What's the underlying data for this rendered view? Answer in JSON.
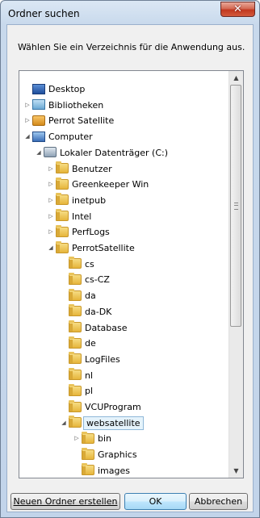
{
  "window": {
    "title": "Ordner suchen",
    "close_label": "✕"
  },
  "description": "Wählen Sie ein Verzeichnis für die Anwendung aus.",
  "tree": [
    {
      "label": "Desktop",
      "icon": "desktop-icon",
      "expander": "",
      "level": 0
    },
    {
      "label": "Bibliotheken",
      "icon": "libraries-icon",
      "expander": "▷",
      "level": 0
    },
    {
      "label": "Perrot Satellite",
      "icon": "user-folder-icon",
      "expander": "▷",
      "level": 0
    },
    {
      "label": "Computer",
      "icon": "computer-icon",
      "expander": "◢",
      "level": 0
    },
    {
      "label": "Lokaler Datenträger (C:)",
      "icon": "drive-icon",
      "expander": "◢",
      "level": 1
    },
    {
      "label": "Benutzer",
      "icon": "folder-icon",
      "expander": "▷",
      "level": 2
    },
    {
      "label": "Greenkeeper Win",
      "icon": "folder-icon",
      "expander": "▷",
      "level": 2
    },
    {
      "label": "inetpub",
      "icon": "folder-icon",
      "expander": "▷",
      "level": 2
    },
    {
      "label": "Intel",
      "icon": "folder-icon",
      "expander": "▷",
      "level": 2
    },
    {
      "label": "PerfLogs",
      "icon": "folder-icon",
      "expander": "▷",
      "level": 2
    },
    {
      "label": "PerrotSatellite",
      "icon": "folder-icon",
      "expander": "◢",
      "level": 2
    },
    {
      "label": "cs",
      "icon": "folder-icon",
      "expander": "",
      "level": 3
    },
    {
      "label": "cs-CZ",
      "icon": "folder-icon",
      "expander": "",
      "level": 3
    },
    {
      "label": "da",
      "icon": "folder-icon",
      "expander": "",
      "level": 3
    },
    {
      "label": "da-DK",
      "icon": "folder-icon",
      "expander": "",
      "level": 3
    },
    {
      "label": "Database",
      "icon": "folder-icon",
      "expander": "",
      "level": 3
    },
    {
      "label": "de",
      "icon": "folder-icon",
      "expander": "",
      "level": 3
    },
    {
      "label": "LogFiles",
      "icon": "folder-icon",
      "expander": "",
      "level": 3
    },
    {
      "label": "nl",
      "icon": "folder-icon",
      "expander": "",
      "level": 3
    },
    {
      "label": "pl",
      "icon": "folder-icon",
      "expander": "",
      "level": 3
    },
    {
      "label": "VCUProgram",
      "icon": "folder-icon",
      "expander": "",
      "level": 3
    },
    {
      "label": "websatellite",
      "icon": "folder-icon",
      "expander": "◢",
      "level": 3,
      "selected": true
    },
    {
      "label": "bin",
      "icon": "folder-icon",
      "expander": "▷",
      "level": 4
    },
    {
      "label": "Graphics",
      "icon": "folder-icon",
      "expander": "",
      "level": 4
    },
    {
      "label": "images",
      "icon": "folder-icon",
      "expander": "",
      "level": 4
    }
  ],
  "buttons": {
    "new_folder": "Neuen Ordner erstellen",
    "ok": "OK",
    "cancel": "Abbrechen"
  },
  "scrollbar": {
    "up": "▲",
    "down": "▼"
  }
}
